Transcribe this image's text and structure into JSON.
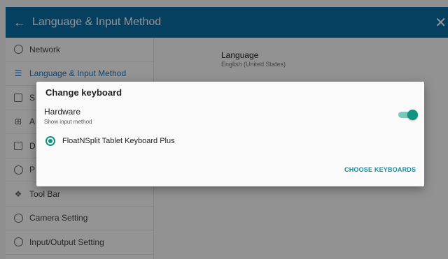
{
  "appbar": {
    "title": "Language & Input Method",
    "back_icon": "arrow-back-icon",
    "close_icon": "close-icon"
  },
  "sidebar": {
    "items": [
      {
        "label": "Network",
        "icon": "globe-icon"
      },
      {
        "label": "Language & Input Method",
        "icon": "list-icon",
        "active": true
      },
      {
        "label": "S",
        "icon": "save-icon"
      },
      {
        "label": "A",
        "icon": "grid-icon"
      },
      {
        "label": "D",
        "icon": "display-icon"
      },
      {
        "label": "P",
        "icon": "power-icon"
      },
      {
        "label": "Tool Bar",
        "icon": "tool-icon"
      },
      {
        "label": "Camera Setting",
        "icon": "camera-icon"
      },
      {
        "label": "Input/Output Setting",
        "icon": "io-icon"
      }
    ]
  },
  "content": {
    "language_title": "Language",
    "language_value": "English (United States)"
  },
  "dialog": {
    "title": "Change keyboard",
    "hardware_title": "Hardware",
    "hardware_subtitle": "Show input method",
    "toggle_on": true,
    "keyboard_option": "FloatNSplit Tablet Keyboard Plus",
    "choose_button": "CHOOSE KEYBOARDS"
  },
  "colors": {
    "accent": "#10927e",
    "appbar": "#0a6ea8",
    "link": "#1a8a9a"
  }
}
